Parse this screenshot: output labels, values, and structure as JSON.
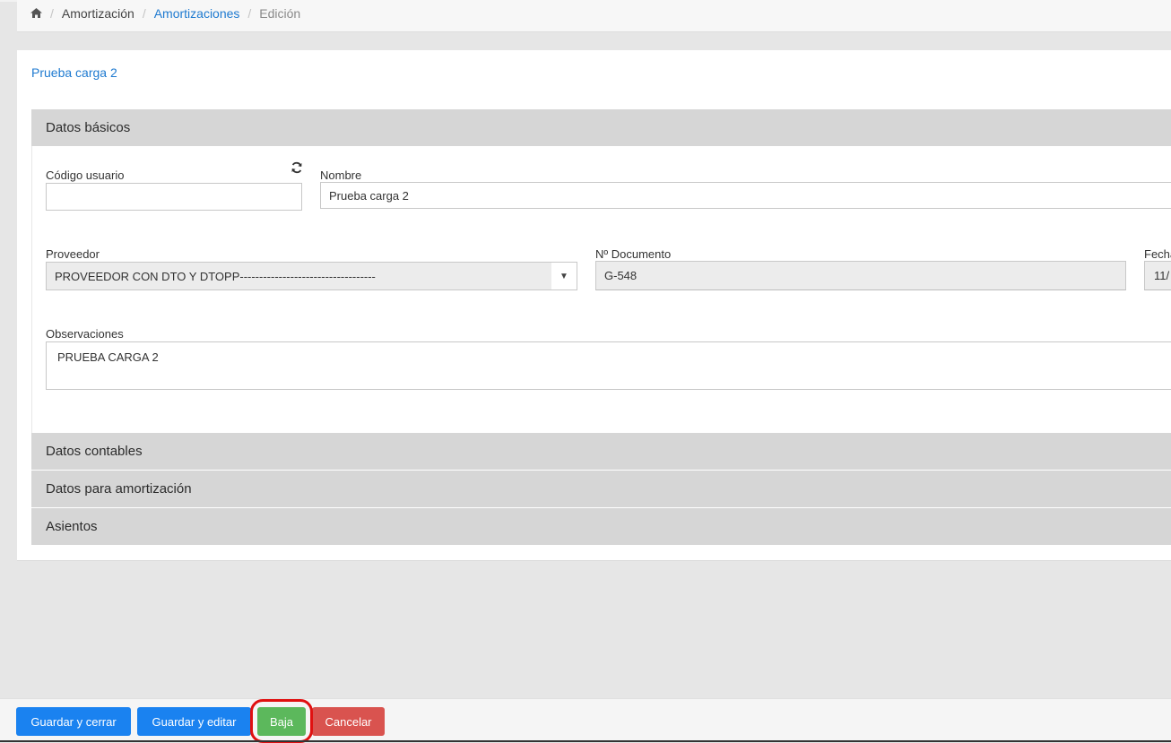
{
  "breadcrumb": {
    "home_icon": "home-icon",
    "items": [
      "Amortización",
      "Amortizaciones",
      "Edición"
    ],
    "separator": "/"
  },
  "card": {
    "title": "Prueba carga 2"
  },
  "sections": {
    "basic": "Datos básicos",
    "accounting": "Datos contables",
    "amortization": "Datos para amortización",
    "entries": "Asientos"
  },
  "form": {
    "codigo_label": "Código usuario",
    "codigo_value": "",
    "refresh_icon": "refresh-icon",
    "nombre_label": "Nombre",
    "nombre_value": "Prueba carga 2",
    "proveedor_label": "Proveedor",
    "proveedor_value": "PROVEEDOR CON DTO Y DTOPP-----------------------------------",
    "documento_label": "Nº Documento",
    "documento_value": "G-548",
    "fecha_label": "Fecha",
    "fecha_value": "11/",
    "observaciones_label": "Observaciones",
    "observaciones_value": "PRUEBA CARGA 2"
  },
  "footer": {
    "save_close": "Guardar y cerrar",
    "save_edit": "Guardar y editar",
    "baja": "Baja",
    "cancel": "Cancelar"
  },
  "colors": {
    "primary": "#1a82f0",
    "success": "#5cb85c",
    "danger": "#d9534f",
    "link": "#1e7ad0",
    "highlight": "#e01010"
  }
}
